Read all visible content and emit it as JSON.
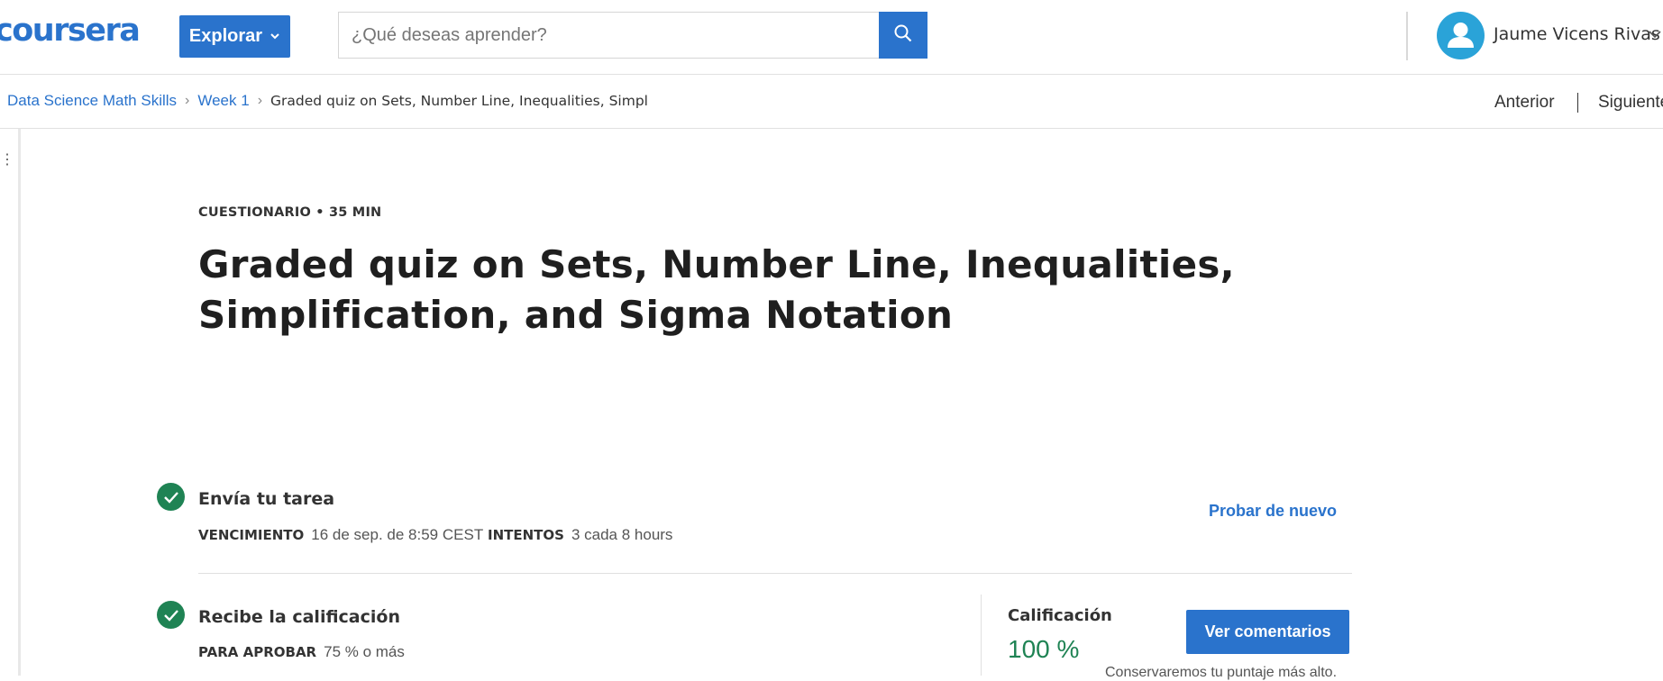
{
  "header": {
    "logo_text": "coursera",
    "explore_label": "Explorar",
    "search_placeholder": "¿Qué deseas aprender?",
    "user_name": "Jaume Vicens Rivas"
  },
  "breadcrumb": {
    "items": [
      "Data Science Math Skills",
      "Week 1"
    ],
    "current": "Graded quiz on Sets, Number Line, Inequalities, Simpl"
  },
  "nav": {
    "previous": "Anterior",
    "next": "Siguiente"
  },
  "quiz": {
    "kicker": "CUESTIONARIO • 35 MIN",
    "title": "Graded quiz on Sets, Number Line, Inequalities, Simplification, and Sigma Notation"
  },
  "submit": {
    "title": "Envía tu tarea",
    "due_label": "VENCIMIENTO",
    "due_value": "16 de sep. de 8:59 CEST",
    "attempts_label": "INTENTOS",
    "attempts_value": "3 cada 8 hours",
    "retry_label": "Probar de nuevo"
  },
  "grade": {
    "title": "Recibe la calificación",
    "pass_label": "PARA APROBAR",
    "pass_value": "75 % o más",
    "grade_label": "Calificación",
    "grade_value": "100 %",
    "feedback_label": "Ver comentarios",
    "keep_note": "Conservaremos tu puntaje más alto."
  },
  "colors": {
    "brand_blue": "#2a73cc",
    "success_green": "#1f8354"
  }
}
